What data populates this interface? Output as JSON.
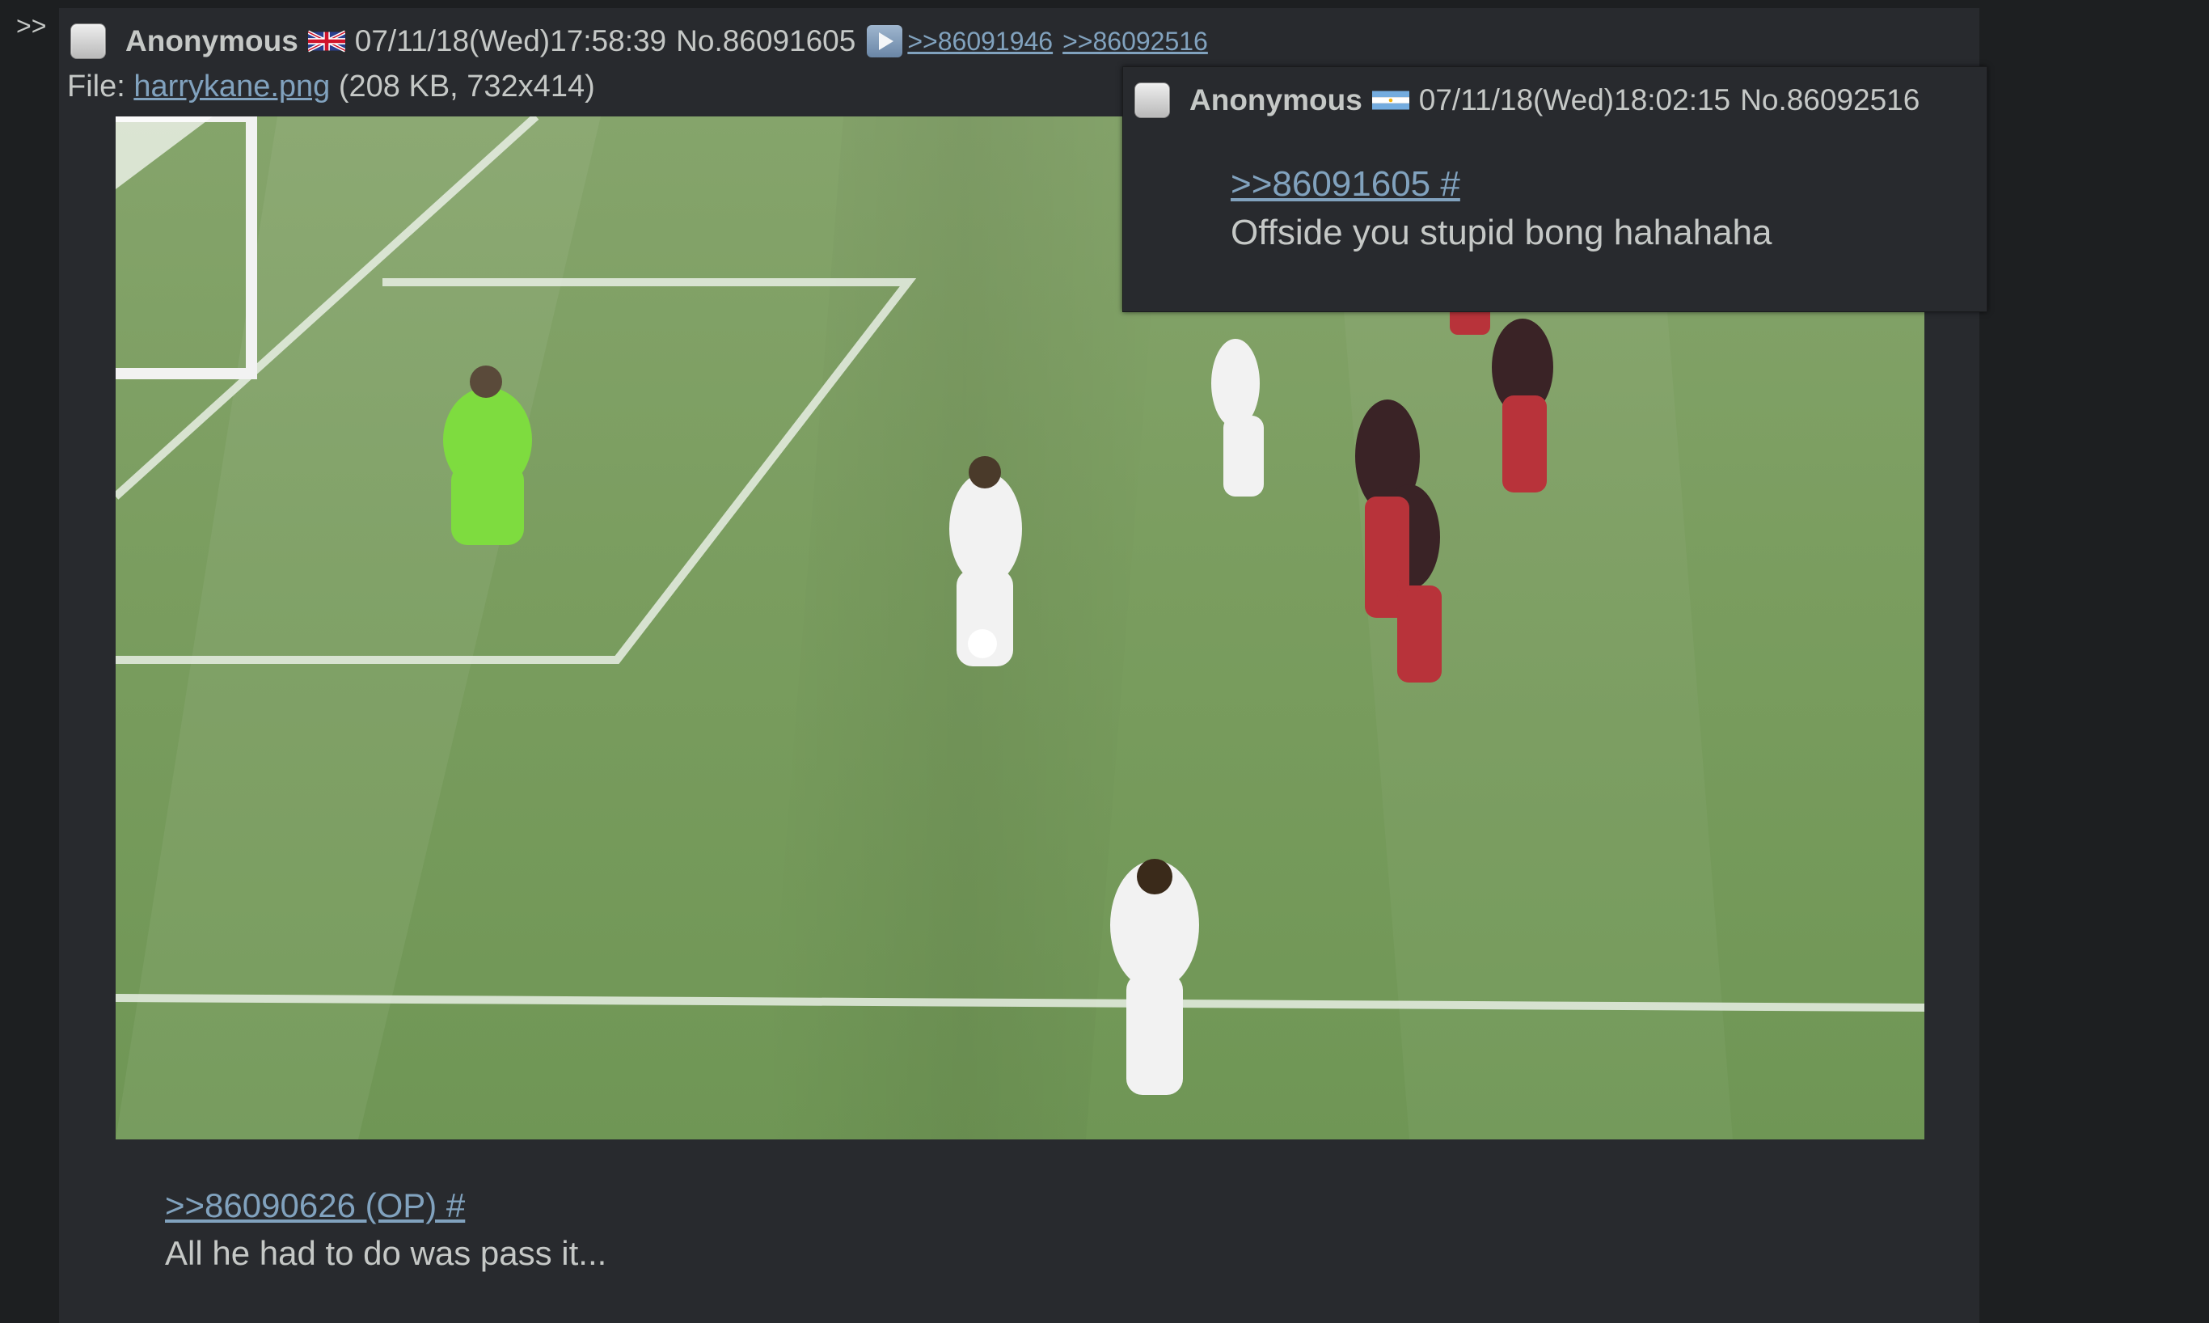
{
  "side": {
    "arrows": ">>"
  },
  "post": {
    "name": "Anonymous",
    "flag": "uk-flag",
    "datetime": "07/11/18(Wed)17:58:39",
    "number": "No.86091605",
    "backlinks": [
      ">>86091946",
      ">>86092516"
    ],
    "file_label": "File: ",
    "file_name": "harrykane.png",
    "file_meta": "(208 KB, 732x414)",
    "quote": ">>86090626 (OP) #",
    "message": "All he had to do was pass it..."
  },
  "popup": {
    "name": "Anonymous",
    "flag": "argentina-flag",
    "datetime": "07/11/18(Wed)18:02:15",
    "number": "No.86092516",
    "quote": ">>86091605 #",
    "message": "Offside you stupid bong hahahaha"
  },
  "colors": {
    "background": "#1d1f21",
    "post_bg": "#282a2e",
    "text": "#c5c8c6",
    "link": "#81a2be"
  }
}
